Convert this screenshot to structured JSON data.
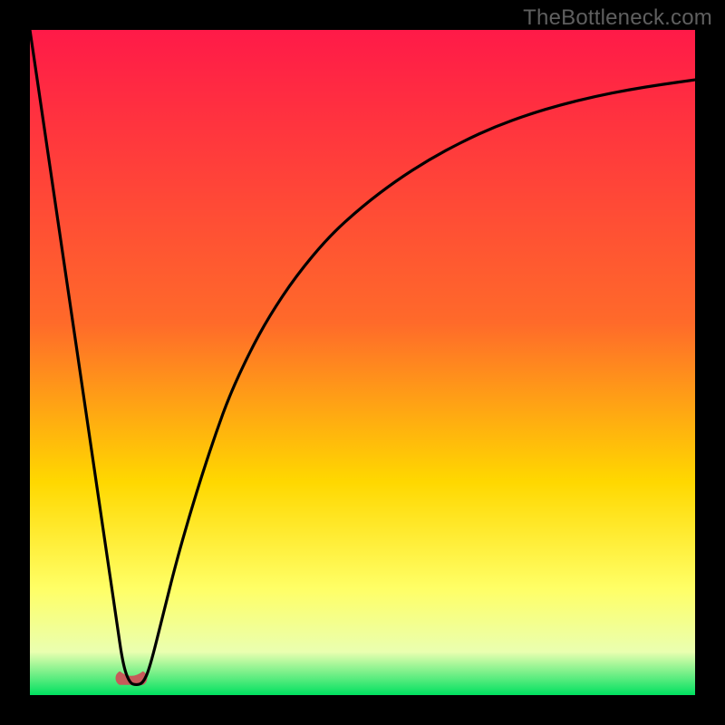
{
  "watermark": "TheBottleneck.com",
  "colors": {
    "gradient_top": "#ff1a48",
    "gradient_mid_top": "#ff6a2a",
    "gradient_mid": "#ffd800",
    "gradient_low": "#ffff66",
    "gradient_band": "#eaffb0",
    "gradient_bottom": "#00e060",
    "curve": "#000000",
    "marker": "#c65a5a",
    "frame": "#000000"
  },
  "chart_data": {
    "type": "line",
    "title": "",
    "xlabel": "",
    "ylabel": "",
    "xlim": [
      0,
      100
    ],
    "ylim": [
      0,
      100
    ],
    "grid": false,
    "legend": false,
    "series": [
      {
        "name": "bottleneck-curve",
        "x": [
          0,
          2,
          4,
          6,
          8,
          10,
          12,
          13,
          14,
          15,
          16,
          17,
          18,
          20,
          22,
          24,
          26,
          28,
          30,
          33,
          36,
          40,
          45,
          50,
          55,
          60,
          65,
          70,
          75,
          80,
          85,
          90,
          95,
          100
        ],
        "y": [
          100,
          86.4,
          72.7,
          59.1,
          45.5,
          31.8,
          18.2,
          11.4,
          4.5,
          1.8,
          1.5,
          1.8,
          4.0,
          12.0,
          20.0,
          27.0,
          33.5,
          39.5,
          45.0,
          51.5,
          57.0,
          63.0,
          69.0,
          73.5,
          77.3,
          80.5,
          83.2,
          85.5,
          87.3,
          88.8,
          90.0,
          91.0,
          91.8,
          92.5
        ]
      }
    ],
    "marker": {
      "name": "optimal-point",
      "x_range": [
        13.5,
        17.0
      ],
      "y": 1.6,
      "shape": "rounded-u"
    },
    "gradient_stops_pct_from_top": [
      {
        "pct": 0,
        "name": "top"
      },
      {
        "pct": 44,
        "name": "mid_top"
      },
      {
        "pct": 68,
        "name": "mid"
      },
      {
        "pct": 84,
        "name": "low"
      },
      {
        "pct": 93.5,
        "name": "band"
      },
      {
        "pct": 100,
        "name": "bottom"
      }
    ]
  }
}
